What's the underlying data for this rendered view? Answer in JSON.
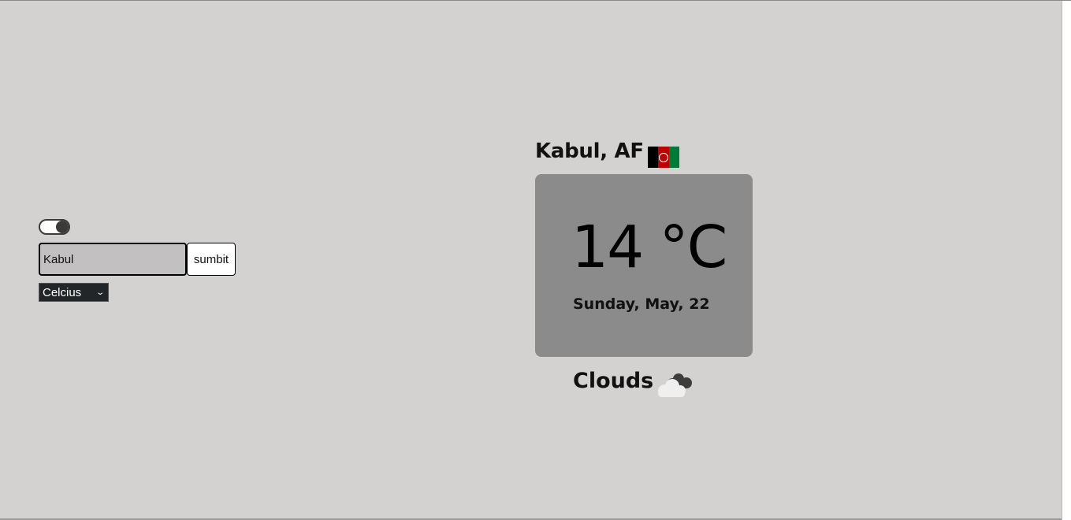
{
  "controls": {
    "theme_toggle": {
      "state": "on",
      "icon": "toggle-icon"
    },
    "search": {
      "value": "Kabul",
      "placeholder": ""
    },
    "submit_label": "sumbit",
    "unit_select": {
      "selected": "Celcius"
    }
  },
  "weather": {
    "location": "Kabul, AF",
    "flag_icon": "afghanistan-flag-icon",
    "temperature": "14 °C",
    "date": "Sunday, May, 22",
    "condition": "Clouds",
    "condition_icon": "cloud-icon"
  },
  "colors": {
    "background": "#d3d2d0",
    "card": "#8c8b8b",
    "input_bg": "#c2c0c0",
    "select_bg": "#232629"
  }
}
